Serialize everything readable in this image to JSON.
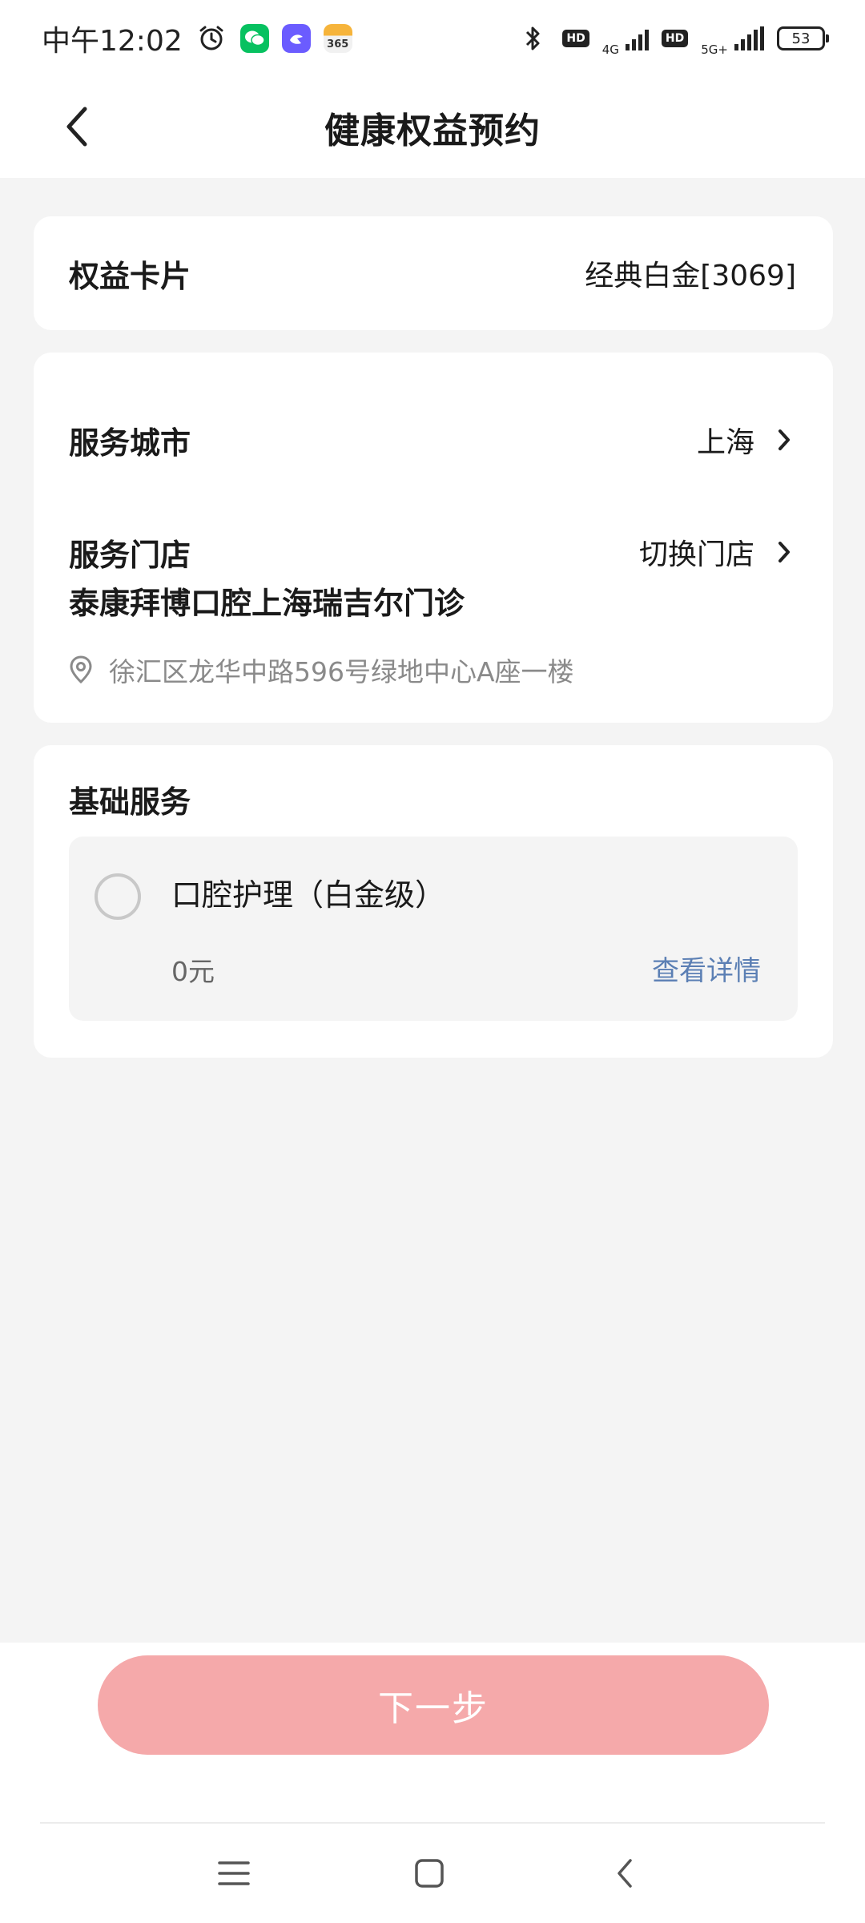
{
  "status_bar": {
    "time": "中午12:02",
    "app_badge_365": "365",
    "hd_badge": "HD",
    "network_1": "4G",
    "network_2": "5G+",
    "battery": "53"
  },
  "header": {
    "title": "健康权益预约"
  },
  "benefit_card": {
    "label": "权益卡片",
    "value": "经典白金[3069]"
  },
  "service_card": {
    "city_label": "服务城市",
    "city_value": "上海",
    "store_label": "服务门店",
    "store_action": "切换门店",
    "store_name": "泰康拜博口腔上海瑞吉尔门诊",
    "store_address": "徐汇区龙华中路596号绿地中心A座一楼"
  },
  "basic_service": {
    "title": "基础服务",
    "items": [
      {
        "name": "口腔护理（白金级）",
        "price": "0元",
        "detail_link": "查看详情"
      }
    ]
  },
  "footer": {
    "next_label": "下一步"
  },
  "colors": {
    "accent_disabled": "#f5a9aa",
    "link": "#5b7fb4",
    "page_bg": "#f4f4f4"
  }
}
